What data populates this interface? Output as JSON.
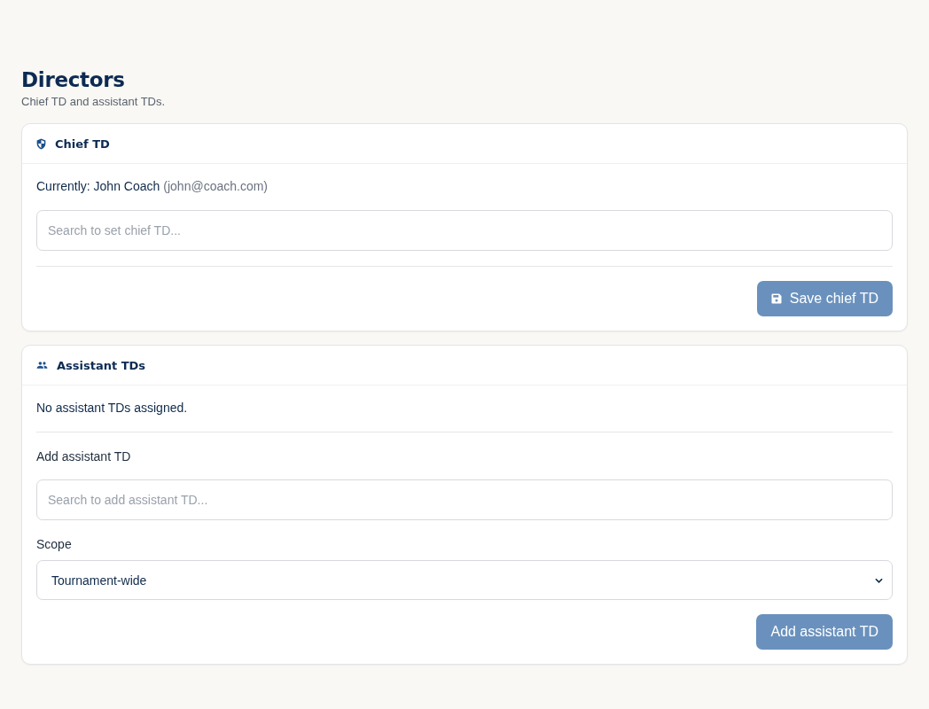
{
  "page": {
    "title": "Directors",
    "subtitle": "Chief TD and assistant TDs."
  },
  "chief_td": {
    "title": "Chief TD",
    "current": "Currently: John Coach",
    "current_email": "(john@coach.com)",
    "search": {
      "placeholder": "Search to set chief TD..."
    },
    "save_button": {
      "label": "Save chief TD",
      "disabled": true
    }
  },
  "assistant_tds": {
    "title": "Assistant TDs",
    "empty_message": "No assistant TDs assigned.",
    "add_label": "Add assistant TD",
    "search": {
      "placeholder": "Search to add assistant TD..."
    },
    "scope_label": "Scope",
    "scope": {
      "value": "Tournament-wide"
    },
    "add_button": {
      "label": "Add assistant TD",
      "disabled": true
    }
  }
}
